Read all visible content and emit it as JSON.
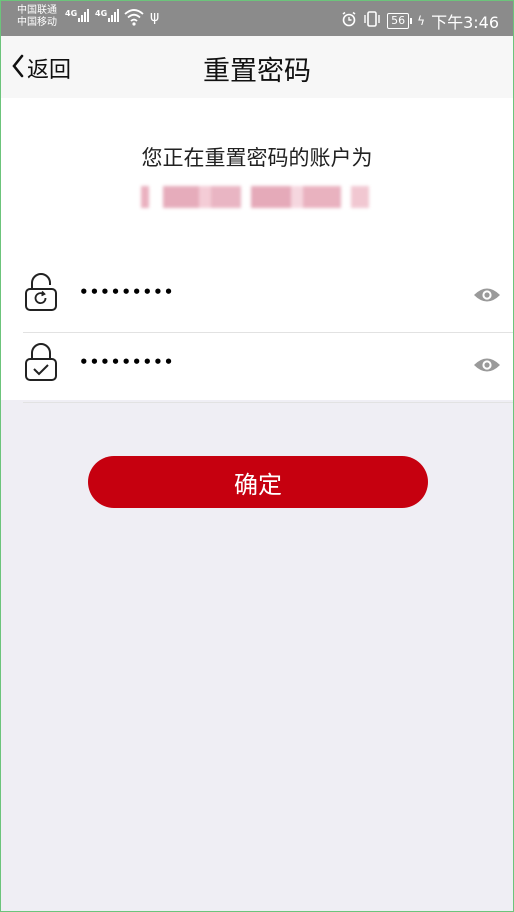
{
  "status_bar": {
    "carrier_1": "中国联通",
    "carrier_2": "中国移动",
    "network_1": "4G",
    "network_2": "4G",
    "battery": "56",
    "time": "下午3:46",
    "icons": [
      "signal-icon",
      "wifi-icon",
      "usb-icon",
      "alarm-icon",
      "vibrate-icon",
      "battery-icon",
      "charging-icon"
    ]
  },
  "nav": {
    "back_label": "返回",
    "title": "重置密码"
  },
  "account_section": {
    "info_text": "您正在重置密码的账户为",
    "account_value": ""
  },
  "form": {
    "new_password": {
      "value": "•••••••••",
      "icon": "lock-refresh-icon"
    },
    "confirm_password": {
      "value": "•••••••••",
      "icon": "lock-check-icon"
    }
  },
  "actions": {
    "confirm_label": "确定"
  },
  "colors": {
    "primary": "#c6000f",
    "status_bar_bg": "#8b8b8b",
    "nav_bg": "#f7f7f7",
    "page_bg": "#efeef4",
    "eye_icon": "#9a9a9a"
  }
}
